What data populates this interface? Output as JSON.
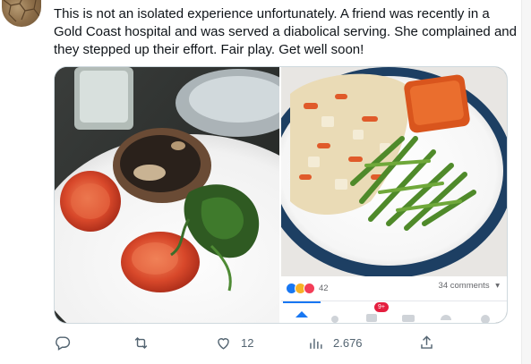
{
  "tweet": {
    "text": "This is not an isolated experience unfortunately. A friend was recently in a Gold Coast hospital and was served a diabolical serving. She complained and they stepped up their effort. Fair play. Get well soon!"
  },
  "media": {
    "left_photo_alt": "hospital-meal-photo",
    "right_screenshot": {
      "reaction_count": "42",
      "comments_label": "34 comments",
      "notification_badge": "9+"
    }
  },
  "actions": {
    "reply_icon": "reply-icon",
    "retweet_icon": "retweet-icon",
    "like_icon": "like-icon",
    "like_count": "12",
    "views_icon": "views-icon",
    "views_count": "2.676",
    "share_icon": "share-icon"
  },
  "colors": {
    "text": "#0f1419",
    "muted": "#536471",
    "border": "#cfd9de",
    "facebook_blue": "#1877f2",
    "badge_red": "#e41e3f"
  }
}
